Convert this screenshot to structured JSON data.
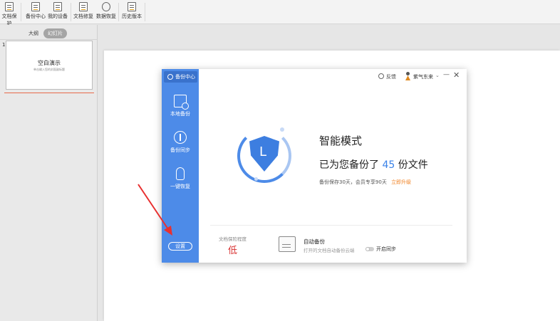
{
  "toolbar": {
    "items": [
      {
        "label": "文档保护"
      },
      {
        "label": "备份中心"
      },
      {
        "label": "我的设备"
      },
      {
        "label": "文档修复"
      },
      {
        "label": "数据恢复"
      },
      {
        "label": "历史版本"
      }
    ]
  },
  "left_panel": {
    "tab_outline": "大纲",
    "tab_slides": "幻灯片",
    "slide_number": "1",
    "slide_title": "空白演示",
    "slide_subtitle": "单击输入您的封面副标题"
  },
  "dialog": {
    "header": "备份中心",
    "sidebar": {
      "local_backup": "本地备份",
      "backup_sync": "备份同步",
      "one_click_restore": "一键恢复",
      "settings": "设置"
    },
    "topbar": {
      "feedback": "反馈",
      "username": "紫气东来",
      "chevron": "⌄",
      "minimize": "—",
      "close": "✕"
    },
    "shield_letter": "L",
    "mode_title": "智能模式",
    "backup_prefix": "已为您备份了",
    "backup_count": "45",
    "backup_suffix": "份文件",
    "backup_sub": "备份保存30天，会员专享90天",
    "upgrade": "立即升级",
    "risk_label": "文档保险程度",
    "risk_value": "低",
    "auto_backup_title": "自动备份",
    "auto_backup_sub": "打开的文档自动备份云端",
    "sync_label": "开启同步"
  },
  "colors": {
    "sidebar_blue": "#4d8be8",
    "accent_blue": "#3a82e8",
    "upgrade_orange": "#f08020",
    "risk_red": "#d83030",
    "arrow_red": "#e83030"
  }
}
